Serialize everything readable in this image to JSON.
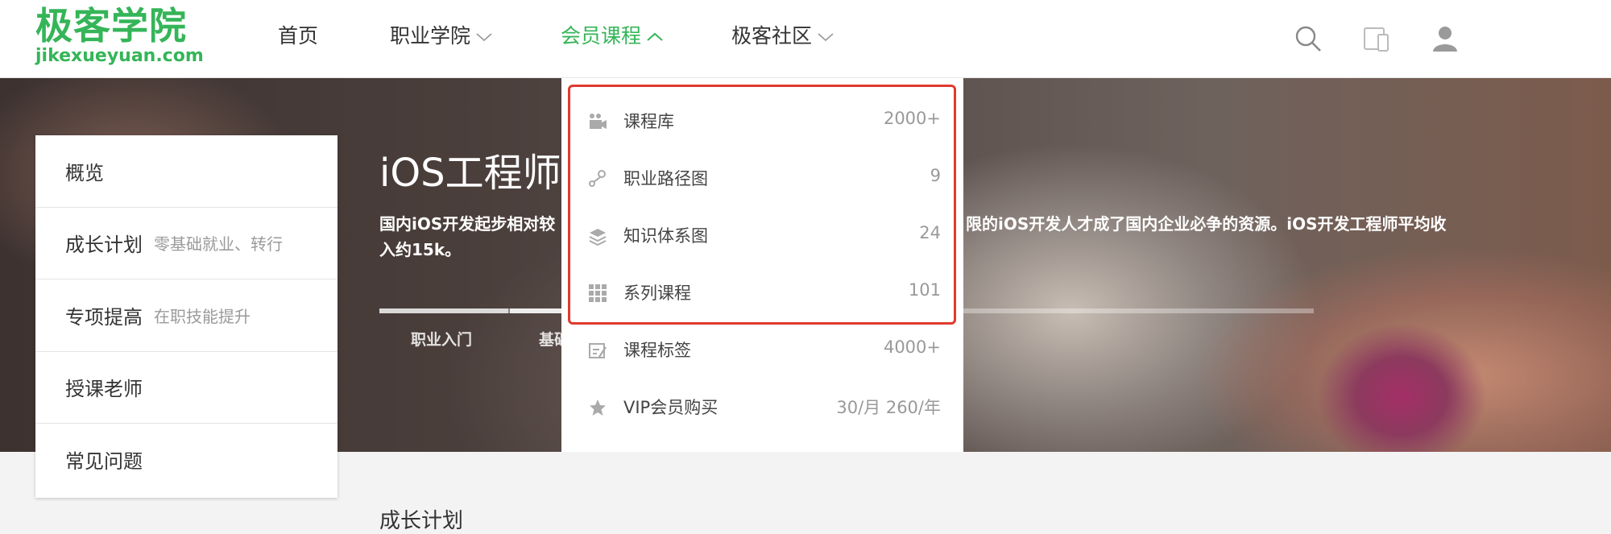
{
  "logo": {
    "cn": "极客学院",
    "en": "jikexueyuan.com"
  },
  "nav": [
    {
      "label": "首页"
    },
    {
      "label": "职业学院"
    },
    {
      "label": "会员课程"
    },
    {
      "label": "极客社区"
    }
  ],
  "header_icons": [
    "search-icon",
    "device-icon",
    "user-icon"
  ],
  "hero": {
    "title": "iOS工程师",
    "desc_line1": "国内iOS开发起步相对较",
    "desc_line1_right": "限的iOS开发人才成了国内企业必争的资源。iOS开发工程师平均收",
    "desc_line2": "入约15k。",
    "steps": [
      "职业入门",
      "基础"
    ]
  },
  "sidebar": [
    {
      "label": "概览",
      "sub": ""
    },
    {
      "label": "成长计划",
      "sub": "零基础就业、转行"
    },
    {
      "label": "专项提高",
      "sub": "在职技能提升"
    },
    {
      "label": "授课老师",
      "sub": ""
    },
    {
      "label": "常见问题",
      "sub": ""
    }
  ],
  "dropdown": [
    {
      "label": "课程库",
      "count": "2000+",
      "icon": "video-icon"
    },
    {
      "label": "职业路径图",
      "count": "9",
      "icon": "path-icon"
    },
    {
      "label": "知识体系图",
      "count": "24",
      "icon": "stack-icon"
    },
    {
      "label": "系列课程",
      "count": "101",
      "icon": "grid-icon"
    },
    {
      "label": "课程标签",
      "count": "4000+",
      "icon": "tag-icon"
    },
    {
      "label": "VIP会员购买",
      "count": "30/月 260/年",
      "icon": "star-icon"
    }
  ],
  "bottom_title": "成长计划",
  "colors": {
    "brand": "#35b558",
    "highlight": "#e03a2e"
  }
}
